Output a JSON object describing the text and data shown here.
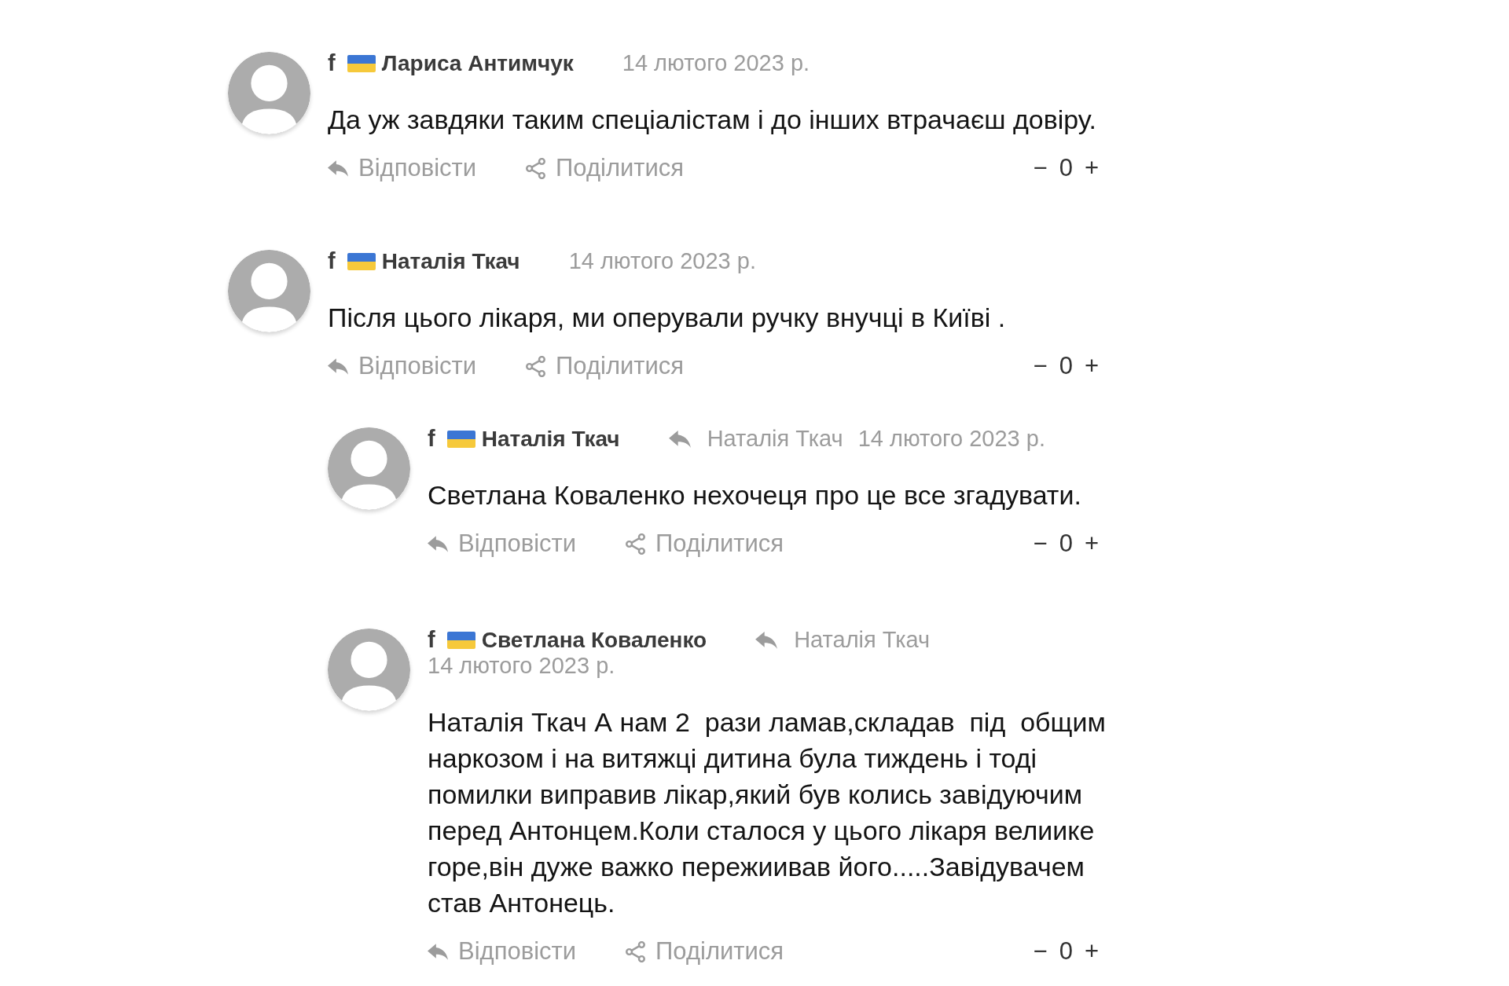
{
  "comments": [
    {
      "source_mark": "f",
      "author": "Лариса Антимчук",
      "date": "14 лютого 2023 р.",
      "text": "Да уж завдяки таким спеціалістам і до інших втрачаєш довіру.",
      "actions": {
        "reply": "Відповісти",
        "share": "Поділитися"
      },
      "vote": {
        "down": "−",
        "score": "0",
        "up": "+"
      }
    },
    {
      "source_mark": "f",
      "author": "Наталія Ткач",
      "date": "14 лютого 2023 р.",
      "text": "Після цього лікаря, ми оперували ручку внучці в Київі .",
      "actions": {
        "reply": "Відповісти",
        "share": "Поділитися"
      },
      "vote": {
        "down": "−",
        "score": "0",
        "up": "+"
      },
      "replies": [
        {
          "source_mark": "f",
          "author": "Наталія Ткач",
          "reply_to": "Наталія Ткач",
          "date": "14 лютого 2023 р.",
          "text": "Светлана Коваленко нехочеця про це все згадувати.",
          "actions": {
            "reply": "Відповісти",
            "share": "Поділитися"
          },
          "vote": {
            "down": "−",
            "score": "0",
            "up": "+"
          }
        },
        {
          "source_mark": "f",
          "author": "Светлана Коваленко",
          "reply_to": "Наталія Ткач",
          "date": "14 лютого 2023 р.",
          "text": "Наталія Ткач А нам 2  рази ламав,складав  під  общим наркозом і на витяжці дитина була тиждень і тоді помилки виправив лікар,який був колись завідуючим перед Антонцем.Коли сталося у цього лікаря велиике горе,він дуже важко пережиивав його.....Завідувачем став Антонець.",
          "actions": {
            "reply": "Відповісти",
            "share": "Поділитися"
          },
          "vote": {
            "down": "−",
            "score": "0",
            "up": "+"
          }
        }
      ]
    }
  ]
}
